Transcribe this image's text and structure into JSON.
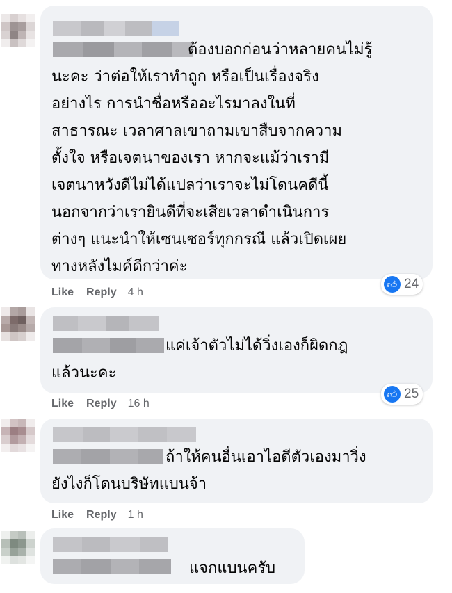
{
  "comments": [
    {
      "text": "ต้องบอกก่อนว่าหลายคนไม่รู้\nนะคะ ว่าต่อให้เราทำถูก หรือเป็นเรื่องจริง\nอย่างไร การนำชื่อหรืออะไรมาลงในที่\nสาธารณะ เวลาศาลเขาถามเขาสืบจากความ\nตั้งใจ หรือเจตนาของเรา หากจะแม้ว่าเรามี\nเจตนาหวังดีไม่ได้แปลว่าเราจะไม่โดนคดีนี้\nนอกจากว่าเรายินดีที่จะเสียเวลาดำเนินการ\nต่างๆ แนะนำให้เซนเซอร์ทุกกรณี แล้วเปิดเผย\nทางหลังไมค์ดีกว่าค่ะ",
      "like_label": "Like",
      "reply_label": "Reply",
      "time": "4 h",
      "reactions": {
        "icon": "like-icon",
        "count": "24"
      }
    },
    {
      "text": "แค่เจ้าตัวไม่ได้วิ่งเองก็ผิดกฎ\nแล้วนะคะ",
      "like_label": "Like",
      "reply_label": "Reply",
      "time": "16 h",
      "reactions": {
        "icon": "like-icon",
        "count": "25"
      }
    },
    {
      "text": "ถ้าให้คนอื่นเอาไอดีตัวเองมาวิ่ง\nยังไงก็โดนบริษัทแบนจ้า",
      "like_label": "Like",
      "reply_label": "Reply",
      "time": "1 h"
    },
    {
      "text": "แจกแบนครับ"
    }
  ],
  "colors": {
    "bubble": "#f0f2f5",
    "meta_text": "#65676b",
    "like_blue": "#1877f2"
  }
}
